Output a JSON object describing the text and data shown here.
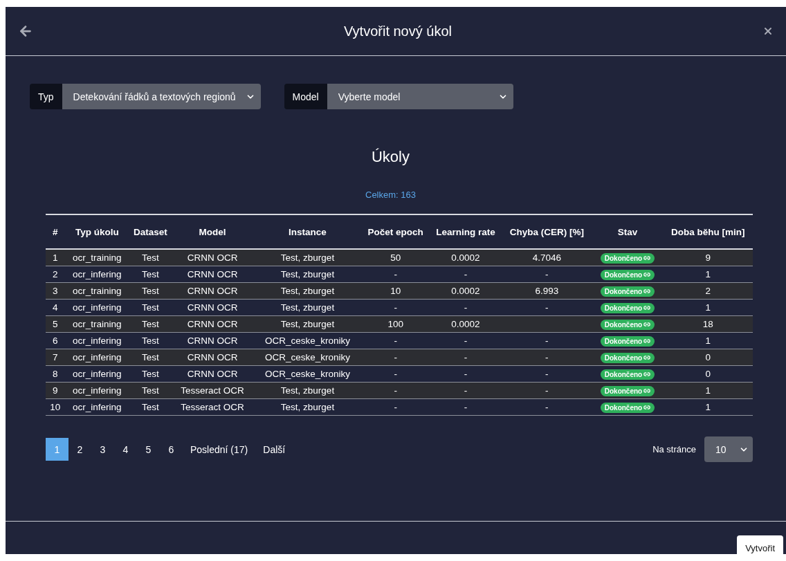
{
  "dialog": {
    "title": "Vytvořit nový úkol"
  },
  "filters": [
    {
      "label": "Typ",
      "value": "Detekování řádků a textových regionů"
    },
    {
      "label": "Model",
      "value": "Vyberte model"
    }
  ],
  "tasks": {
    "title": "Úkoly",
    "total": "Celkem: 163",
    "columns": [
      "#",
      "Typ úkolu",
      "Dataset",
      "Model",
      "Instance",
      "Počet epoch",
      "Learning rate",
      "Chyba (CER) [%]",
      "Stav",
      "Doba běhu [min]"
    ],
    "rows": [
      {
        "num": "1",
        "type": "ocr_training",
        "dataset": "Test",
        "model": "CRNN OCR",
        "instance": "Test, zburget",
        "epochs": "50",
        "lr": "0.0002",
        "error": "4.7046",
        "status": "Dokončeno",
        "duration": "9"
      },
      {
        "num": "2",
        "type": "ocr_infering",
        "dataset": "Test",
        "model": "CRNN OCR",
        "instance": "Test, zburget",
        "epochs": "-",
        "lr": "-",
        "error": "-",
        "status": "Dokončeno",
        "duration": "1"
      },
      {
        "num": "3",
        "type": "ocr_training",
        "dataset": "Test",
        "model": "CRNN OCR",
        "instance": "Test, zburget",
        "epochs": "10",
        "lr": "0.0002",
        "error": "6.993",
        "status": "Dokončeno",
        "duration": "2"
      },
      {
        "num": "4",
        "type": "ocr_infering",
        "dataset": "Test",
        "model": "CRNN OCR",
        "instance": "Test, zburget",
        "epochs": "-",
        "lr": "-",
        "error": "-",
        "status": "Dokončeno",
        "duration": "1"
      },
      {
        "num": "5",
        "type": "ocr_training",
        "dataset": "Test",
        "model": "CRNN OCR",
        "instance": "Test, zburget",
        "epochs": "100",
        "lr": "0.0002",
        "status": "Dokončeno",
        "duration": "18"
      },
      {
        "num": "6",
        "type": "ocr_infering",
        "dataset": "Test",
        "model": "CRNN OCR",
        "instance": "OCR_ceske_kroniky",
        "epochs": "-",
        "lr": "-",
        "error": "-",
        "status": "Dokončeno",
        "duration": "1"
      },
      {
        "num": "7",
        "type": "ocr_infering",
        "dataset": "Test",
        "model": "CRNN OCR",
        "instance": "OCR_ceske_kroniky",
        "epochs": "-",
        "lr": "-",
        "error": "-",
        "status": "Dokončeno",
        "duration": "0"
      },
      {
        "num": "8",
        "type": "ocr_infering",
        "dataset": "Test",
        "model": "CRNN OCR",
        "instance": "OCR_ceske_kroniky",
        "epochs": "-",
        "lr": "-",
        "error": "-",
        "status": "Dokončeno",
        "duration": "0"
      },
      {
        "num": "9",
        "type": "ocr_infering",
        "dataset": "Test",
        "model": "Tesseract OCR",
        "instance": "Test, zburget",
        "epochs": "-",
        "lr": "-",
        "error": "-",
        "status": "Dokončeno",
        "duration": "1"
      },
      {
        "num": "10",
        "type": "ocr_infering",
        "dataset": "Test",
        "model": "Tesseract OCR",
        "instance": "Test, zburget",
        "epochs": "-",
        "lr": "-",
        "error": "-",
        "status": "Dokončeno",
        "duration": "1"
      }
    ]
  },
  "pagination": {
    "pages": [
      {
        "label": "1",
        "selected": true
      },
      {
        "label": "2",
        "selected": false
      },
      {
        "label": "3",
        "selected": false
      },
      {
        "label": "4",
        "selected": false
      },
      {
        "label": "5",
        "selected": false
      },
      {
        "label": "6",
        "selected": false
      }
    ],
    "last": "Poslední (17)",
    "next": "Další",
    "per_page_label": "Na stránce",
    "per_page": "10"
  },
  "footer": {
    "button": "Vytvořit"
  }
}
